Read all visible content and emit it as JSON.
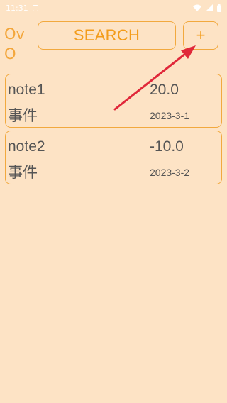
{
  "status_bar": {
    "time": "11:31"
  },
  "header": {
    "brand_line1": "Ov",
    "brand_line2": "O",
    "search_label": "SEARCH",
    "add_label": "+"
  },
  "notes": [
    {
      "title": "note1",
      "amount": "20.0",
      "category": "事件",
      "date": "2023-3-1"
    },
    {
      "title": "note2",
      "amount": "-10.0",
      "category": "事件",
      "date": "2023-3-2"
    }
  ],
  "colors": {
    "background": "#FDE3C5",
    "accent": "#F39C1A",
    "border": "#F2A93E",
    "text": "#555555",
    "annotation_arrow": "#E0283A"
  },
  "icons": {
    "notification": "notification-icon",
    "wifi": "wifi-icon",
    "signal": "signal-icon",
    "battery": "battery-icon",
    "annotation": "red-arrow-annotation"
  }
}
